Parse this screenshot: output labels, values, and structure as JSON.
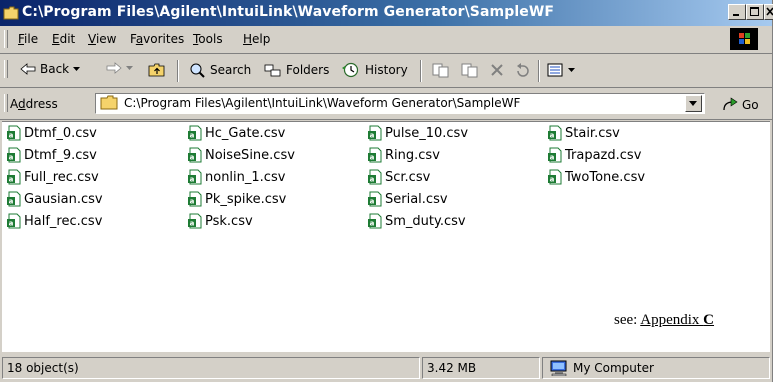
{
  "window": {
    "title": "C:\\Program Files\\Agilent\\IntuiLink\\Waveform Generator\\SampleWF"
  },
  "menu": [
    {
      "acc": "F",
      "rest": "ile"
    },
    {
      "acc": "E",
      "rest": "dit"
    },
    {
      "acc": "V",
      "rest": "iew"
    },
    {
      "pre": "F",
      "acc": "a",
      "rest": "vorites"
    },
    {
      "acc": "T",
      "rest": "ools"
    },
    {
      "acc": "H",
      "rest": "elp"
    }
  ],
  "toolbar": {
    "back": "Back",
    "search": "Search",
    "folders": "Folders",
    "history": "History"
  },
  "address": {
    "label_pre": "A",
    "label_acc": "d",
    "label_rest": "dress",
    "value": "C:\\Program Files\\Agilent\\IntuiLink\\Waveform Generator\\SampleWF",
    "go": "Go"
  },
  "files": [
    "Dtmf_0.csv",
    "Dtmf_9.csv",
    "Full_rec.csv",
    "Gausian.csv",
    "Half_rec.csv",
    "Hc_Gate.csv",
    "NoiseSine.csv",
    "nonlin_1.csv",
    "Pk_spike.csv",
    "Psk.csv",
    "Pulse_10.csv",
    "Ring.csv",
    "Scr.csv",
    "Serial.csv",
    "Sm_duty.csv",
    "Stair.csv",
    "Trapazd.csv",
    "TwoTone.csv"
  ],
  "note": {
    "prefix": "see: ",
    "link": "Appendix ",
    "bold": "C"
  },
  "status": {
    "objects": "18 object(s)",
    "size": "3.42 MB",
    "zone": "My Computer"
  },
  "colors": {
    "title_start": "#0a246a",
    "title_end": "#a6caf0",
    "face": "#d4d0c8",
    "excel_green": "#1e7b34"
  }
}
